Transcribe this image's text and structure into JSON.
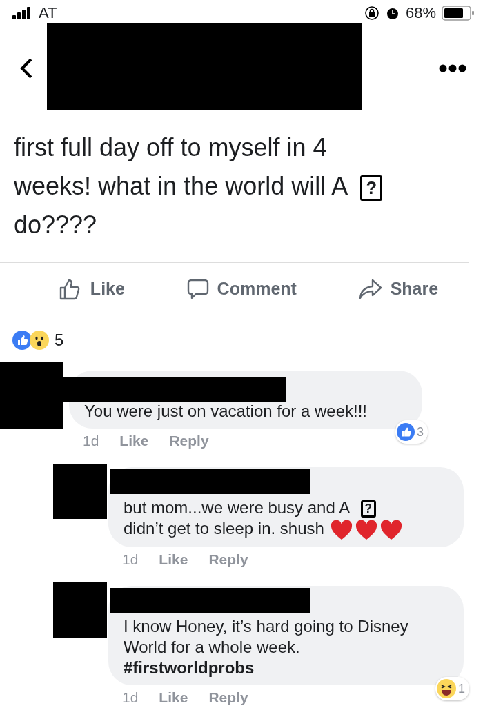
{
  "status_bar": {
    "carrier": "AT",
    "battery": "68%"
  },
  "post": {
    "parts": [
      {
        "kind": "text",
        "text": "first full day off to myself in 4 weeks! what in the world will A"
      },
      {
        "kind": "glyph",
        "text": "?"
      },
      {
        "kind": "text",
        "text": "do????"
      }
    ]
  },
  "actions": [
    {
      "kind": "like",
      "label": "Like"
    },
    {
      "kind": "comment",
      "label": "Comment"
    },
    {
      "kind": "share",
      "label": "Share"
    }
  ],
  "reactions": {
    "count": "5"
  },
  "comments": [
    {
      "parts": [
        {
          "kind": "text",
          "text": "You were just on vacation for a week!!!"
        }
      ],
      "time": "1d",
      "like": "Like",
      "reply": "Reply",
      "reaction": {
        "kind": "like",
        "count": "3"
      },
      "replies": [
        {
          "parts": [
            {
              "kind": "text",
              "text": "but mom...we were busy and A"
            },
            {
              "kind": "glyph",
              "text": "?"
            },
            {
              "kind": "text",
              "text": "didn’t get to sleep in. shush"
            },
            {
              "kind": "heart"
            },
            {
              "kind": "heart"
            },
            {
              "kind": "heart"
            }
          ],
          "time": "1d",
          "like": "Like",
          "reply": "Reply"
        },
        {
          "parts": [
            {
              "kind": "paragraph",
              "text": "I know Honey, it’s hard going to Disney World for a whole week."
            },
            {
              "kind": "hashtag",
              "text": "#firstworldprobs"
            }
          ],
          "time": "1d",
          "like": "Like",
          "reply": "Reply",
          "reaction": {
            "kind": "haha",
            "count": "1"
          }
        }
      ]
    }
  ]
}
